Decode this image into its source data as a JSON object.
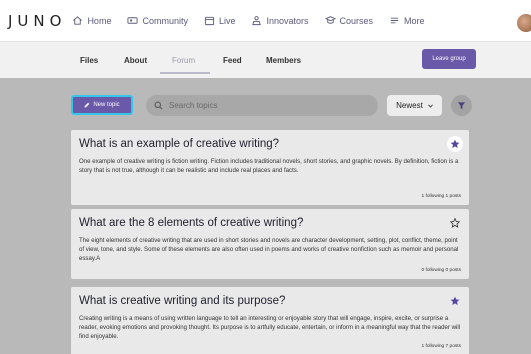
{
  "app": {
    "logo": "JUNO"
  },
  "nav": [
    {
      "label": "Home",
      "icon": "home-icon"
    },
    {
      "label": "Community",
      "icon": "community-icon"
    },
    {
      "label": "Live",
      "icon": "calendar-icon"
    },
    {
      "label": "Innovators",
      "icon": "innovators-icon"
    },
    {
      "label": "Courses",
      "icon": "courses-icon"
    },
    {
      "label": "More",
      "icon": "more-icon"
    }
  ],
  "subnav": {
    "tabs": [
      {
        "label": "Files"
      },
      {
        "label": "About"
      },
      {
        "label": "Forum",
        "active": true
      },
      {
        "label": "Feed"
      },
      {
        "label": "Members"
      }
    ],
    "leave_label": "Leave group"
  },
  "toolbar": {
    "new_topic_label": "New topic",
    "search_placeholder": "Search topics",
    "sort_selected": "Newest"
  },
  "topics": [
    {
      "title": "What is an example of creative writing?",
      "body": "One example of creative writing is fiction writing. Fiction includes traditional novels, short stories, and graphic novels. By definition, fiction is a story that is not true, although it can be realistic and include real places and facts.",
      "stats": "1 following  1 posts",
      "starred": true
    },
    {
      "title": "What are the 8 elements of creative writing?",
      "body": "The eight elements of creative writing that are used in short stories and novels are character development, setting, plot, conflict, theme, point of view, tone, and style. Some of these elements are also often used in poems and works of creative nonfiction such as memoir and personal essay.A",
      "stats": "0 following  0 posts",
      "starred": false
    },
    {
      "title": "What is creative writing and its purpose?",
      "body": "Creating writing is a means of using written language to tell an interesting or enjoyable story that will engage, inspire, excite, or surprise a reader, evoking emotions and provoking thought. Its purpose is to artfully educate, entertain, or inform in a meaningful way that the reader will find enjoyable.",
      "stats": "1 following  7 posts",
      "starred": true
    }
  ],
  "colors": {
    "accent": "#6a58a8",
    "focus_ring": "#33c6e8",
    "overlay": "#b9b9b9"
  }
}
